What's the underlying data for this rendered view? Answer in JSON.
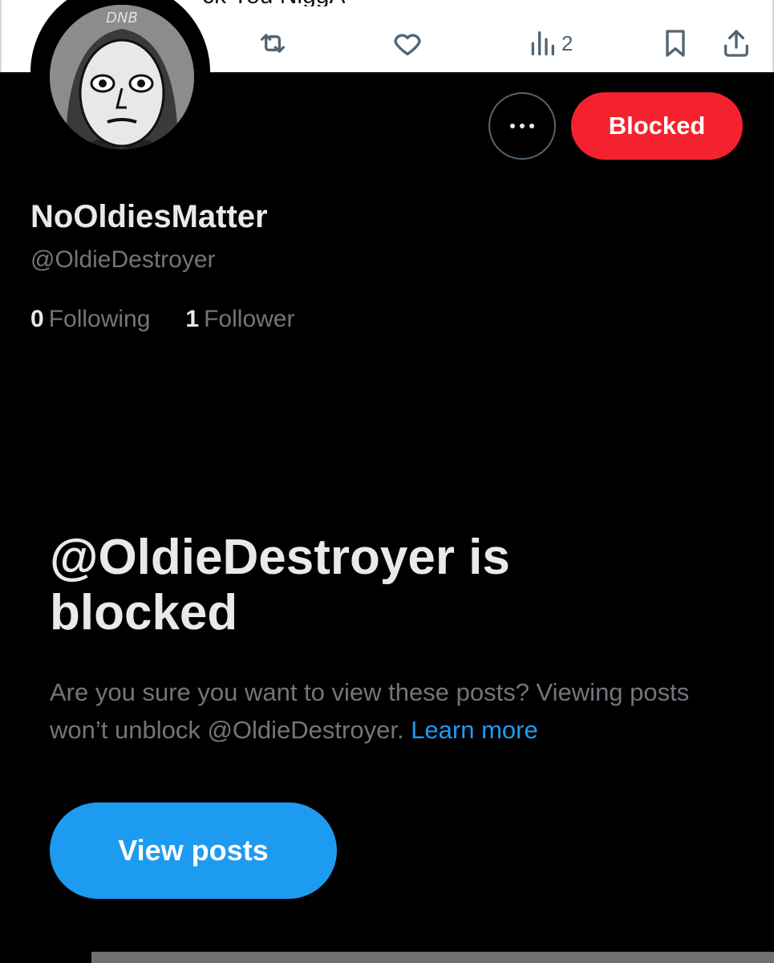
{
  "tweet_strip": {
    "text_fragment": "ck You NiggA",
    "views_count": "2"
  },
  "avatar": {
    "label": "DNB"
  },
  "actions": {
    "more_label": "•••",
    "blocked_label": "Blocked"
  },
  "profile": {
    "display_name": "NoOldiesMatter",
    "handle": "@OldieDestroyer",
    "following_count": "0",
    "following_label": "Following",
    "followers_count": "1",
    "followers_label": "Follower"
  },
  "blocked_notice": {
    "title": "@OldieDestroyer is blocked",
    "description": "Are you sure you want to view these posts? Viewing posts won’t unblock @OldieDestroyer.",
    "learn_more": "Learn more",
    "view_posts_label": "View posts"
  },
  "colors": {
    "background": "#000000",
    "blocked_red": "#f4212e",
    "accent_blue": "#1d9bf0",
    "secondary_text": "#71767b"
  }
}
